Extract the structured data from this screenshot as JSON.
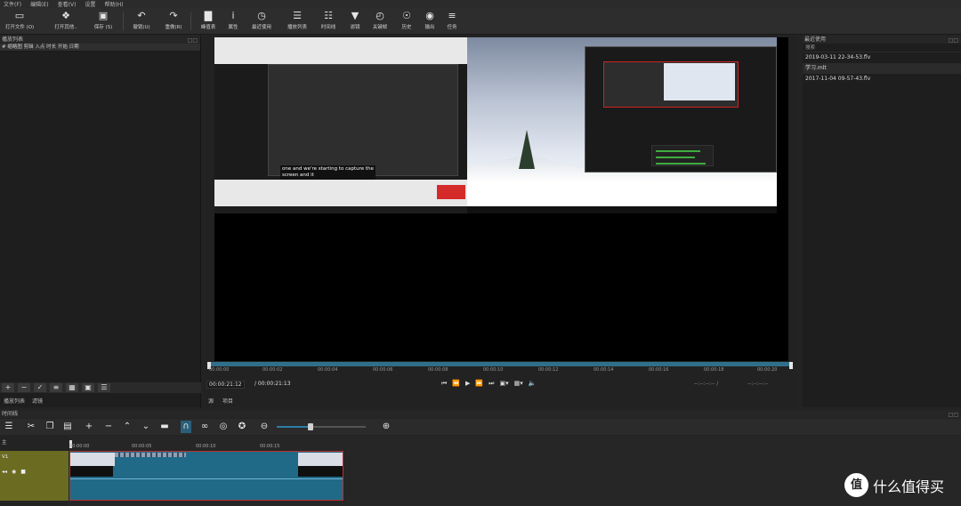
{
  "menu": [
    "文件(F)",
    "编辑(E)",
    "查看(V)",
    "设置",
    "帮助(H)"
  ],
  "toolbar": {
    "items": [
      {
        "label": "打开文件 (O)",
        "icon": "folder-open-icon"
      },
      {
        "label": "打开其他..",
        "icon": "open-other-icon"
      },
      {
        "label": "保存 (S)",
        "icon": "save-icon"
      },
      {
        "label": "撤销(U)",
        "icon": "undo-icon"
      },
      {
        "label": "重做(R)",
        "icon": "redo-icon"
      },
      {
        "label": "峰值表",
        "icon": "peak-meter-icon"
      },
      {
        "label": "属性",
        "icon": "info-icon"
      },
      {
        "label": "最近使用",
        "icon": "recent-icon"
      },
      {
        "label": "播放列表",
        "icon": "playlist-icon"
      },
      {
        "label": "时间线",
        "icon": "timeline-icon"
      },
      {
        "label": "滤镜",
        "icon": "filter-icon"
      },
      {
        "label": "关键帧",
        "icon": "keyframe-icon"
      },
      {
        "label": "历史",
        "icon": "history-icon"
      },
      {
        "label": "输出",
        "icon": "export-icon"
      },
      {
        "label": "任务",
        "icon": "jobs-icon"
      }
    ]
  },
  "playlist": {
    "title": "播放列表",
    "columns": "#  缩略图  剪辑  入点  时长  开始  日期",
    "tabs": [
      "播放列表",
      "滤镜"
    ]
  },
  "video": {
    "caption_line1": "one and we're starting to capture the",
    "caption_line2": "screen and it"
  },
  "ruler": {
    "ticks": [
      "00:00:00",
      "00:00:02",
      "00:00:04",
      "00:00:06",
      "00:00:08",
      "00:00:10",
      "00:00:12",
      "00:00:14",
      "00:00:16",
      "00:00:18",
      "00:00:20"
    ]
  },
  "transport": {
    "position": "00:00:21:12",
    "duration": "/ 00:00:21:13",
    "in_out_a": "--:--:--:-- /",
    "in_out_b": "--:--:--:--"
  },
  "player_tabs": [
    "源",
    "项目"
  ],
  "recent": {
    "title": "最近使用",
    "search_placeholder": "搜索",
    "items": [
      "2019-03-11 22-34-53.flv",
      "学习.mlt",
      "2017-11-04 09-57-43.flv"
    ]
  },
  "timeline": {
    "title": "时间线",
    "master_label": "主",
    "track_name": "V1",
    "ticks": [
      "00:00:00",
      "00:00:05",
      "00:00:10",
      "00:00:15"
    ],
    "zoom_level": 0.36
  },
  "watermark": {
    "logo": "值",
    "text": "什么值得买"
  },
  "colors": {
    "accent": "#2b7fa6",
    "clip": "#206a88",
    "clip_border": "#b93030",
    "track_head": "#6b6b22"
  }
}
